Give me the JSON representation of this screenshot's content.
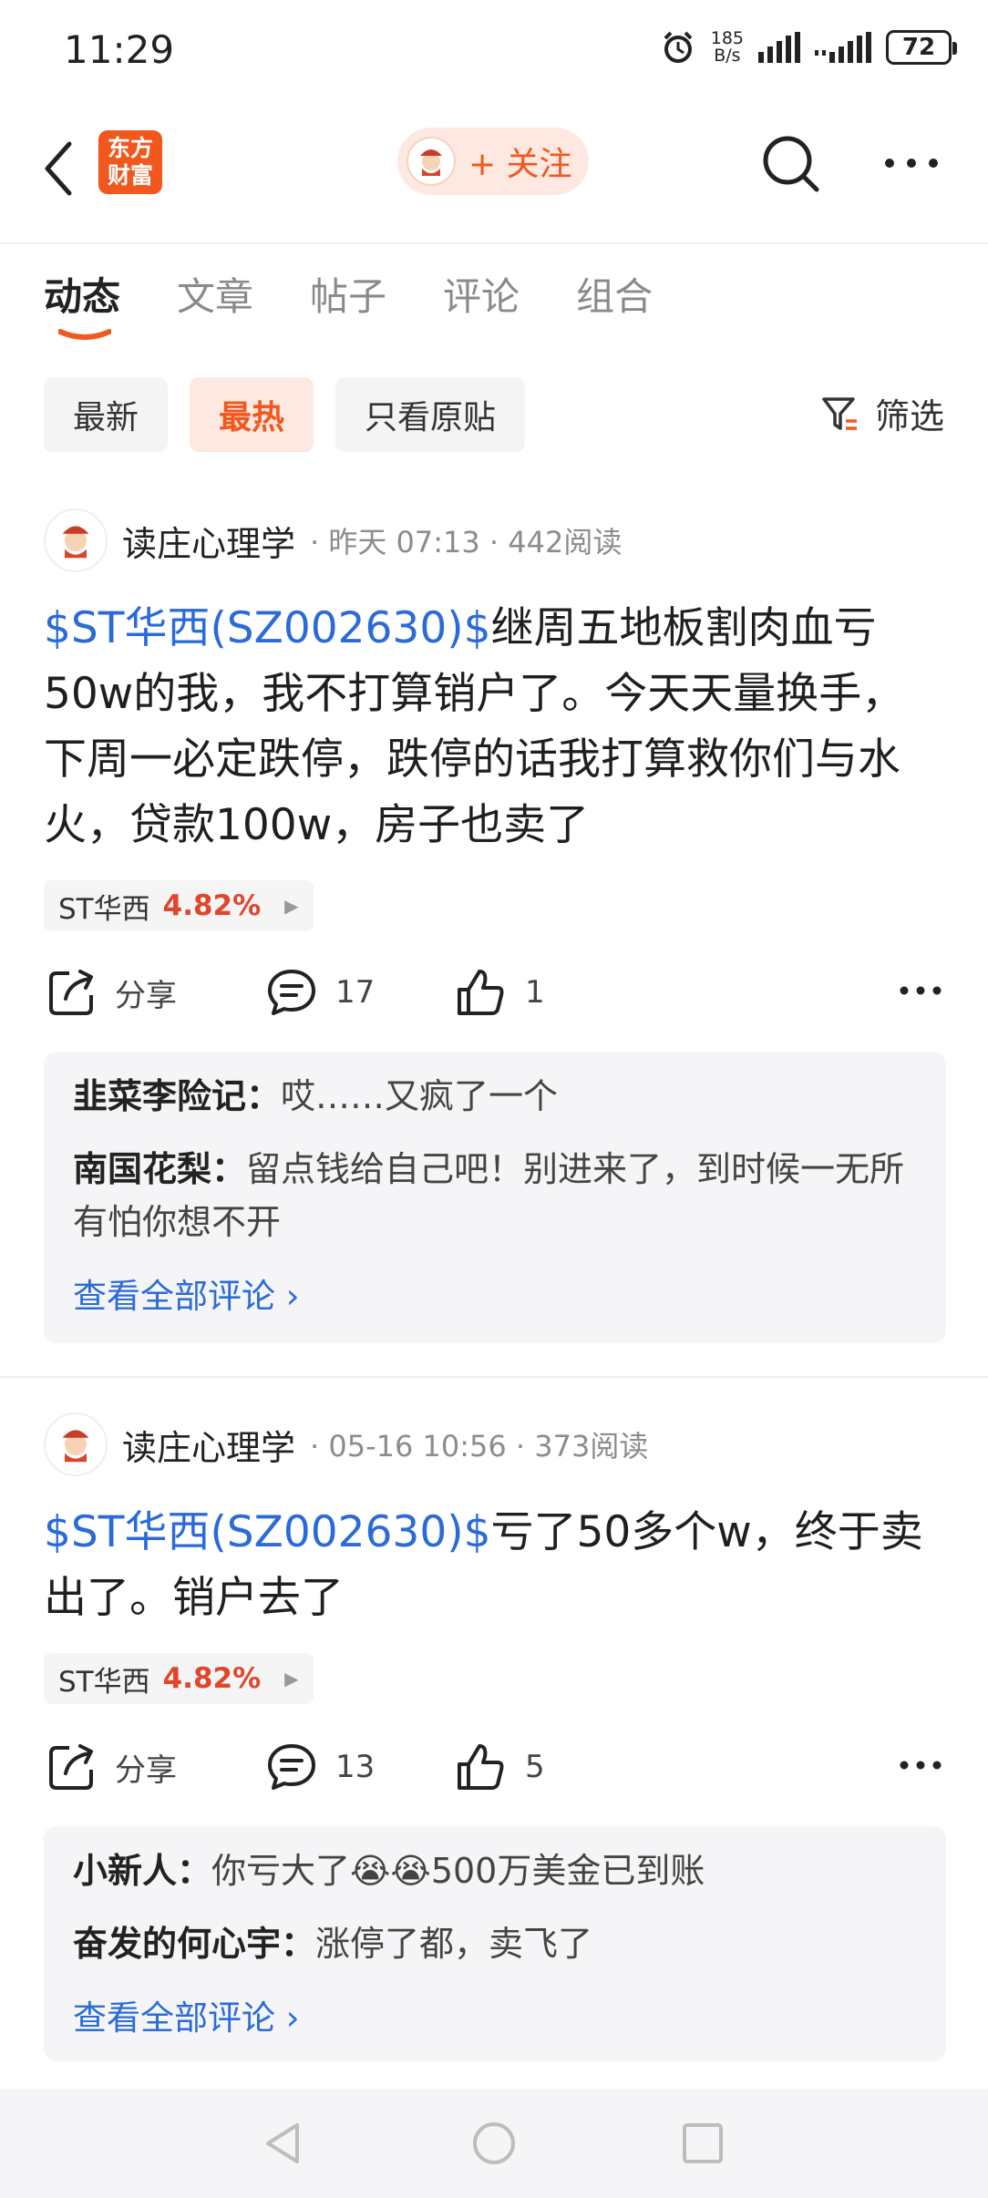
{
  "status_bar": {
    "time": "11:29",
    "net_speed_value": "185",
    "net_speed_unit": "B/s",
    "battery": "72"
  },
  "header": {
    "follow_label": "+ 关注",
    "logo_line1": "东方",
    "logo_line2": "财富"
  },
  "tabs": [
    {
      "label": "动态",
      "active": true
    },
    {
      "label": "文章",
      "active": false
    },
    {
      "label": "帖子",
      "active": false
    },
    {
      "label": "评论",
      "active": false
    },
    {
      "label": "组合",
      "active": false
    }
  ],
  "filters": {
    "chips": [
      {
        "label": "最新",
        "active": false
      },
      {
        "label": "最热",
        "active": true
      },
      {
        "label": "只看原贴",
        "active": false
      }
    ],
    "filter_label": "筛选"
  },
  "posts": [
    {
      "author": "读庄心理学",
      "meta": "· 昨天 07:13 · 442阅读",
      "stock_link": "$ST华西(SZ002630)$",
      "text": "继周五地板割肉血亏50w的我，我不打算销户了。今天天量换手，下周一必定跌停，跌停的话我打算救你们与水火，贷款100w，房子也卖了",
      "tag_name": "ST华西",
      "tag_pct": "4.82%",
      "share_label": "分享",
      "comment_count": "17",
      "like_count": "1",
      "comments": [
        {
          "name": "韭菜李险记：",
          "text": "哎……又疯了一个"
        },
        {
          "name": "南国花梨：",
          "text": "留点钱给自己吧！别进来了，到时候一无所有怕你想不开"
        }
      ],
      "view_all": "查看全部评论 ›"
    },
    {
      "author": "读庄心理学",
      "meta": "· 05-16 10:56 · 373阅读",
      "stock_link": "$ST华西(SZ002630)$",
      "text": "亏了50多个w，终于卖出了。销户去了",
      "tag_name": "ST华西",
      "tag_pct": "4.82%",
      "share_label": "分享",
      "comment_count": "13",
      "like_count": "5",
      "comments": [
        {
          "name": "小新人：",
          "text": "你亏大了😭😭500万美金已到账"
        },
        {
          "name": "奋发的何心宇：",
          "text": "涨停了都，卖飞了"
        }
      ],
      "view_all": "查看全部评论 ›"
    }
  ],
  "colors": {
    "accent": "#f2571d",
    "link": "#2a6bd9",
    "up": "#e0462b"
  },
  "icons": [
    "back-arrow-icon",
    "search-icon",
    "more-icon",
    "filter-icon",
    "share-icon",
    "comment-icon",
    "like-icon",
    "nav-back-icon",
    "nav-home-icon",
    "nav-recent-icon"
  ]
}
